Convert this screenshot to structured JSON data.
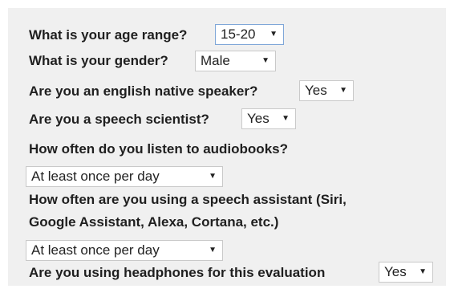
{
  "form": {
    "age": {
      "label": "What is your age range?",
      "selected": "15-20"
    },
    "gender": {
      "label": "What is your gender?",
      "selected": "Male"
    },
    "native": {
      "label": "Are you an english native speaker?",
      "selected": "Yes"
    },
    "scientist": {
      "label": "Are you a speech scientist?",
      "selected": "Yes"
    },
    "audiobooks": {
      "label": "How often do you listen to audiobooks?",
      "selected": "At least once per day"
    },
    "assistant": {
      "label_line1": "How often are you using a speech assistant (Siri,",
      "label_line2": "Google Assistant, Alexa, Cortana, etc.)",
      "selected": "At least once per day"
    },
    "headphones": {
      "label": "Are you using headphones for this evaluation",
      "selected": "Yes"
    }
  },
  "icons": {
    "dropdown_arrow": "▼"
  }
}
